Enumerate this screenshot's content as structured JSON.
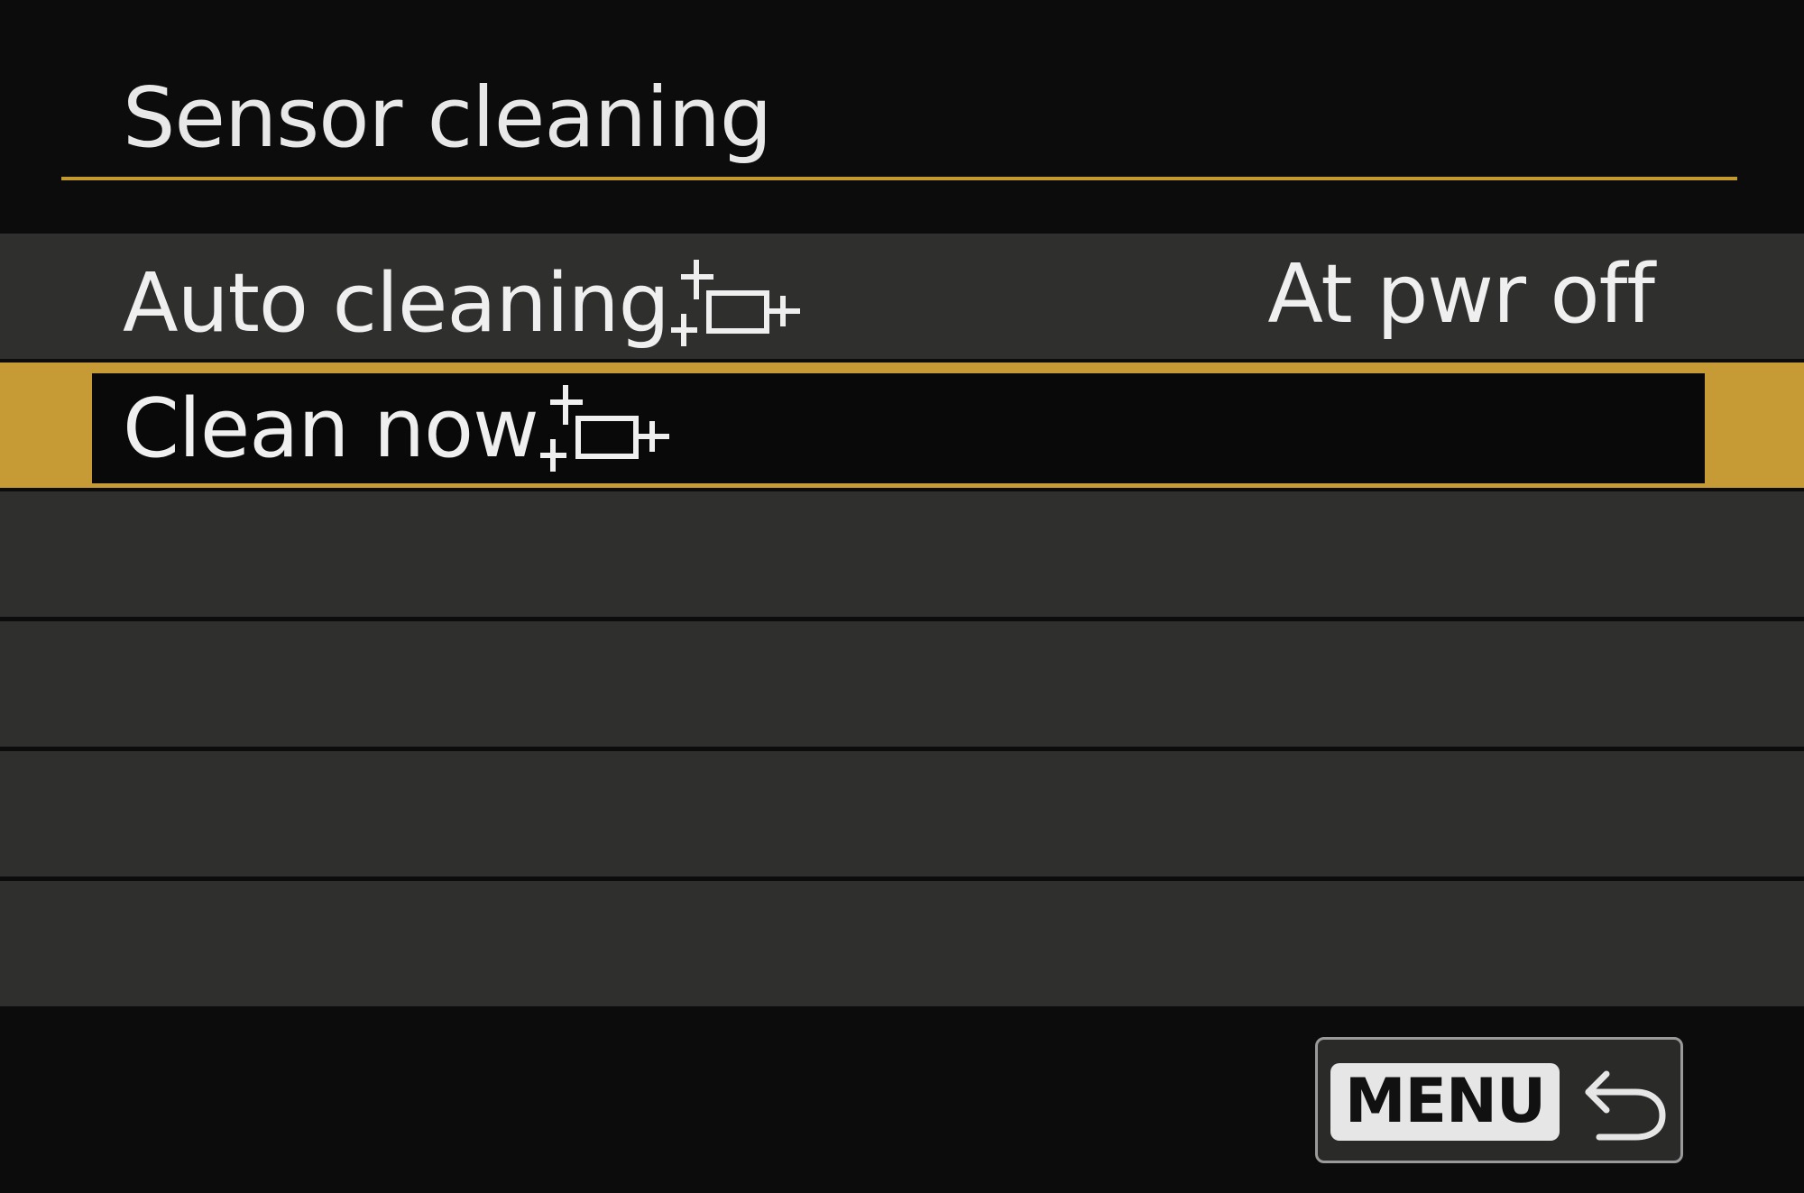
{
  "screen": {
    "title": "Sensor cleaning",
    "accent_color": "#c69b35"
  },
  "menu": {
    "items": [
      {
        "label": "Auto cleaning",
        "icon": "sensor-clean-icon",
        "value": "At pwr off",
        "selected": false
      },
      {
        "label": "Clean now",
        "icon": "sensor-clean-icon",
        "value": "",
        "selected": true
      }
    ]
  },
  "footer": {
    "menu_label": "MENU",
    "back_icon": "return-arrow-icon"
  }
}
